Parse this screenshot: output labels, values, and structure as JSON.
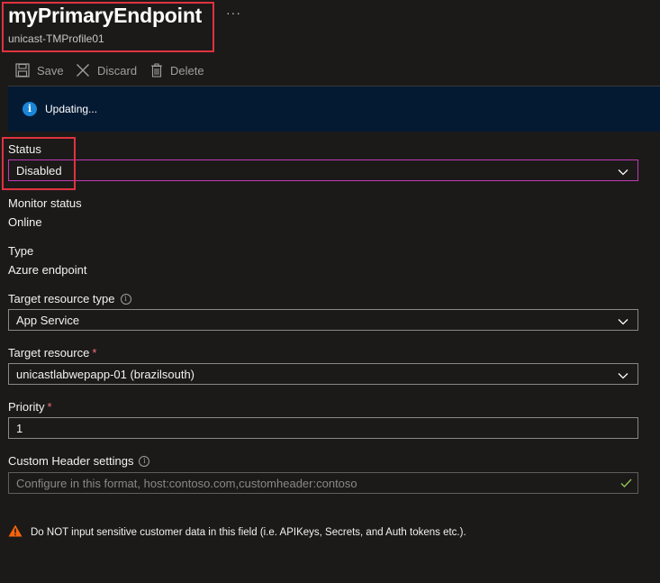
{
  "header": {
    "title": "myPrimaryEndpoint",
    "subtitle": "unicast-TMProfile01",
    "more_label": "···"
  },
  "toolbar": {
    "save_label": "Save",
    "discard_label": "Discard",
    "delete_label": "Delete"
  },
  "notification": {
    "icon": "info-icon",
    "text": "Updating..."
  },
  "form": {
    "status": {
      "label": "Status",
      "value": "Disabled"
    },
    "monitor_status": {
      "label": "Monitor status",
      "value": "Online"
    },
    "type": {
      "label": "Type",
      "value": "Azure endpoint"
    },
    "target_resource_type": {
      "label": "Target resource type",
      "value": "App Service"
    },
    "target_resource": {
      "label": "Target resource",
      "required_mark": "*",
      "value": "unicastlabwepapp-01 (brazilsouth)"
    },
    "priority": {
      "label": "Priority",
      "required_mark": "*",
      "value": "1"
    },
    "custom_header": {
      "label": "Custom Header settings",
      "placeholder": "Configure in this format, host:contoso.com,customheader:contoso"
    }
  },
  "warning": {
    "icon": "warning-icon",
    "text": "Do NOT input sensitive customer data in this field (i.e. APIKeys, Secrets, and Auth tokens etc.)."
  },
  "colors": {
    "background": "#1b1a19",
    "info_bar": "#041a33",
    "highlight_box": "#e0323f",
    "focus_border": "#c239b3",
    "required": "#f1707b",
    "warning": "#f7630c",
    "valid_check": "#92c353"
  }
}
